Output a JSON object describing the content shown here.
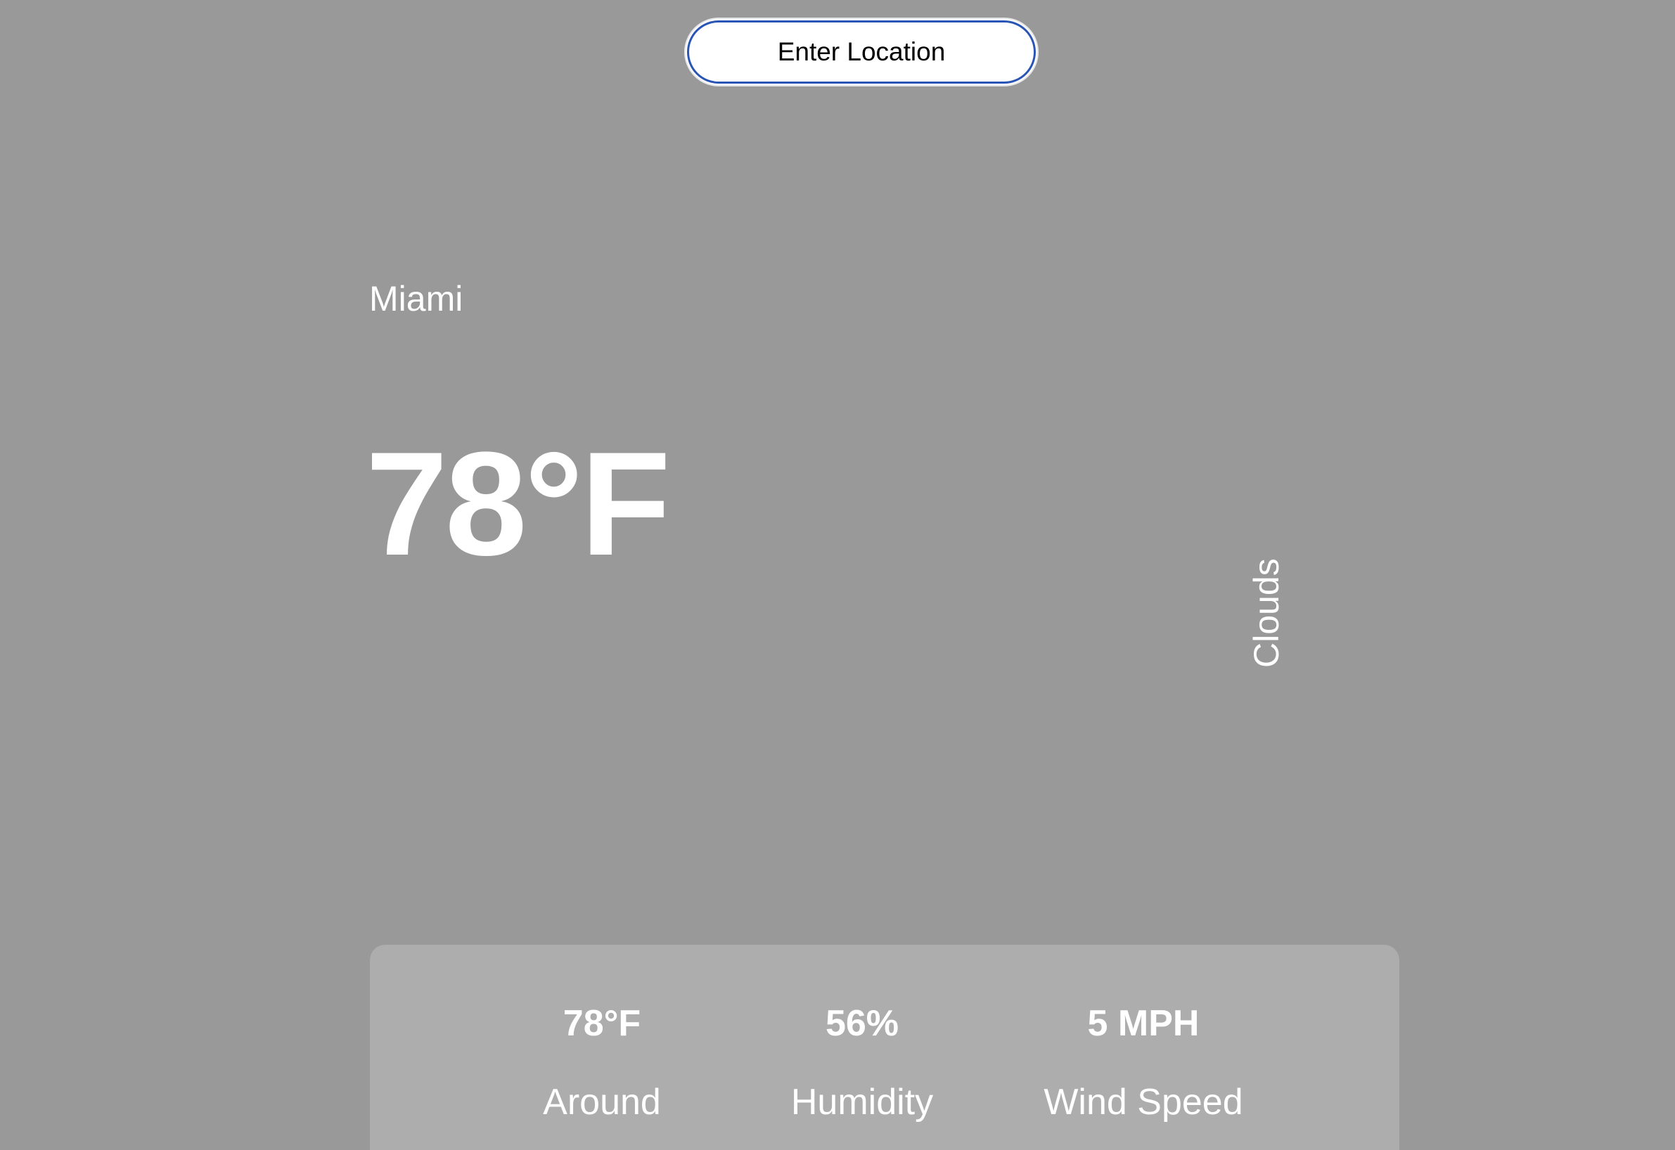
{
  "search": {
    "placeholder": "Enter Location"
  },
  "weather": {
    "location": "Miami",
    "temperature": "78°F",
    "description": "Clouds"
  },
  "stats": [
    {
      "value": "78°F",
      "label": "Around"
    },
    {
      "value": "56%",
      "label": "Humidity"
    },
    {
      "value": "5 MPH",
      "label": "Wind Speed"
    }
  ],
  "colors": {
    "background": "#999999",
    "panel": "#adadad",
    "input_border": "#2b55b5",
    "text": "#ffffff"
  }
}
